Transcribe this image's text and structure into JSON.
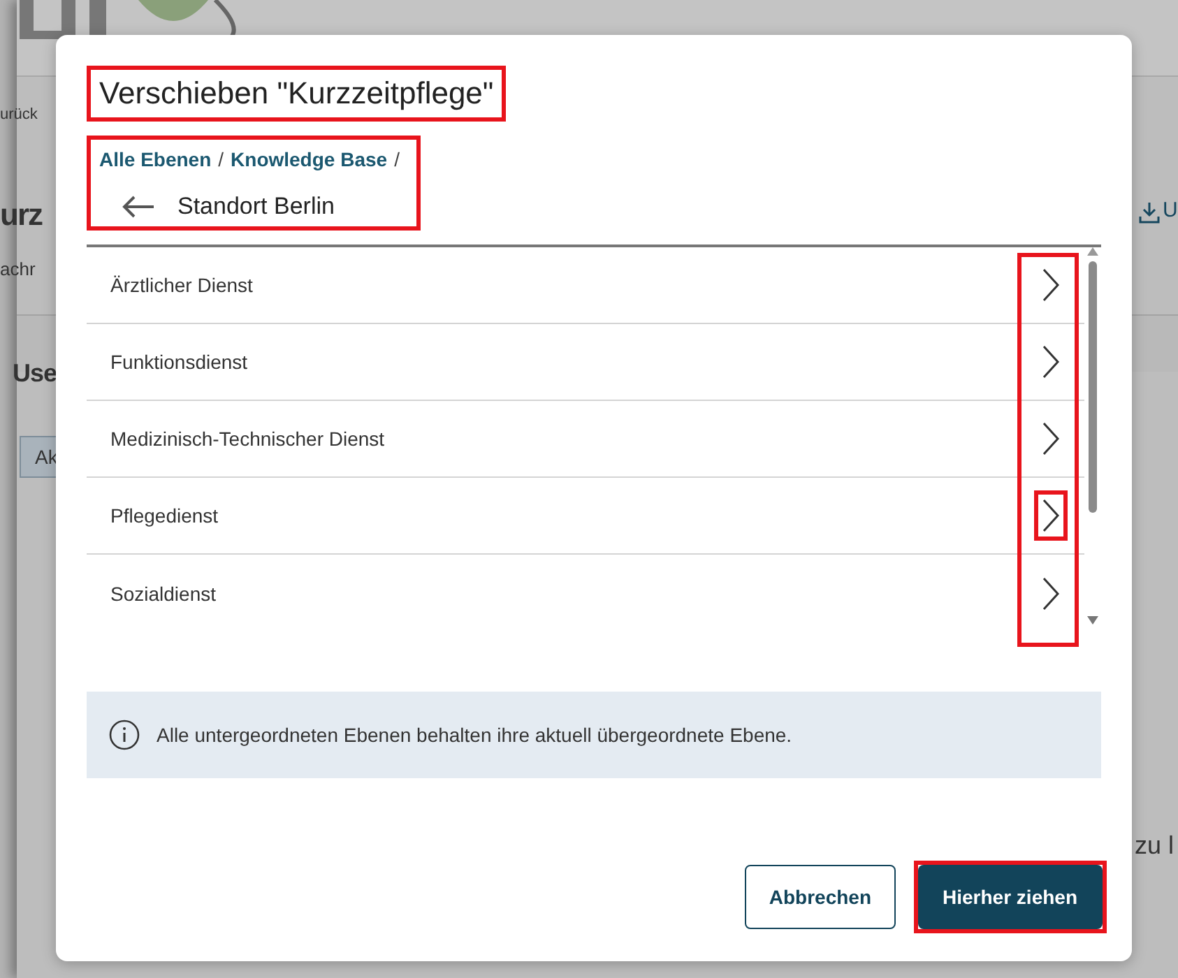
{
  "background": {
    "texts": [
      {
        "kind": "link",
        "text": "urück"
      },
      {
        "kind": "heading",
        "text": "urz"
      },
      {
        "kind": "small",
        "text": "achr"
      },
      {
        "kind": "section",
        "text": "Use"
      },
      {
        "kind": "tab",
        "text": "Ak"
      },
      {
        "kind": "download",
        "text": "U"
      },
      {
        "kind": "side",
        "text": "zu l"
      }
    ]
  },
  "dialog": {
    "title": "Verschieben \"Kurzzeitpflege\"",
    "title_annotated": true,
    "breadcrumb": {
      "annotated": true,
      "items": [
        "Alle Ebenen",
        "Knowledge Base"
      ],
      "separator": "/",
      "current": "Standort Berlin"
    },
    "list": {
      "chevrons_annotated": true,
      "items": [
        {
          "label": "Ärztlicher Dienst",
          "annotated": false
        },
        {
          "label": "Funktionsdienst",
          "annotated": false
        },
        {
          "label": "Medizinisch-Technischer Dienst",
          "annotated": false
        },
        {
          "label": "Pflegedienst",
          "annotated": true
        },
        {
          "label": "Sozialdienst",
          "annotated": false
        }
      ]
    },
    "info": "Alle untergeordneten Ebenen behalten ihre aktuell übergeordnete Ebene.",
    "buttons": [
      {
        "label": "Abbrechen",
        "kind": "secondary",
        "annotated": false
      },
      {
        "label": "Hierher ziehen",
        "kind": "primary",
        "annotated": true
      }
    ]
  }
}
